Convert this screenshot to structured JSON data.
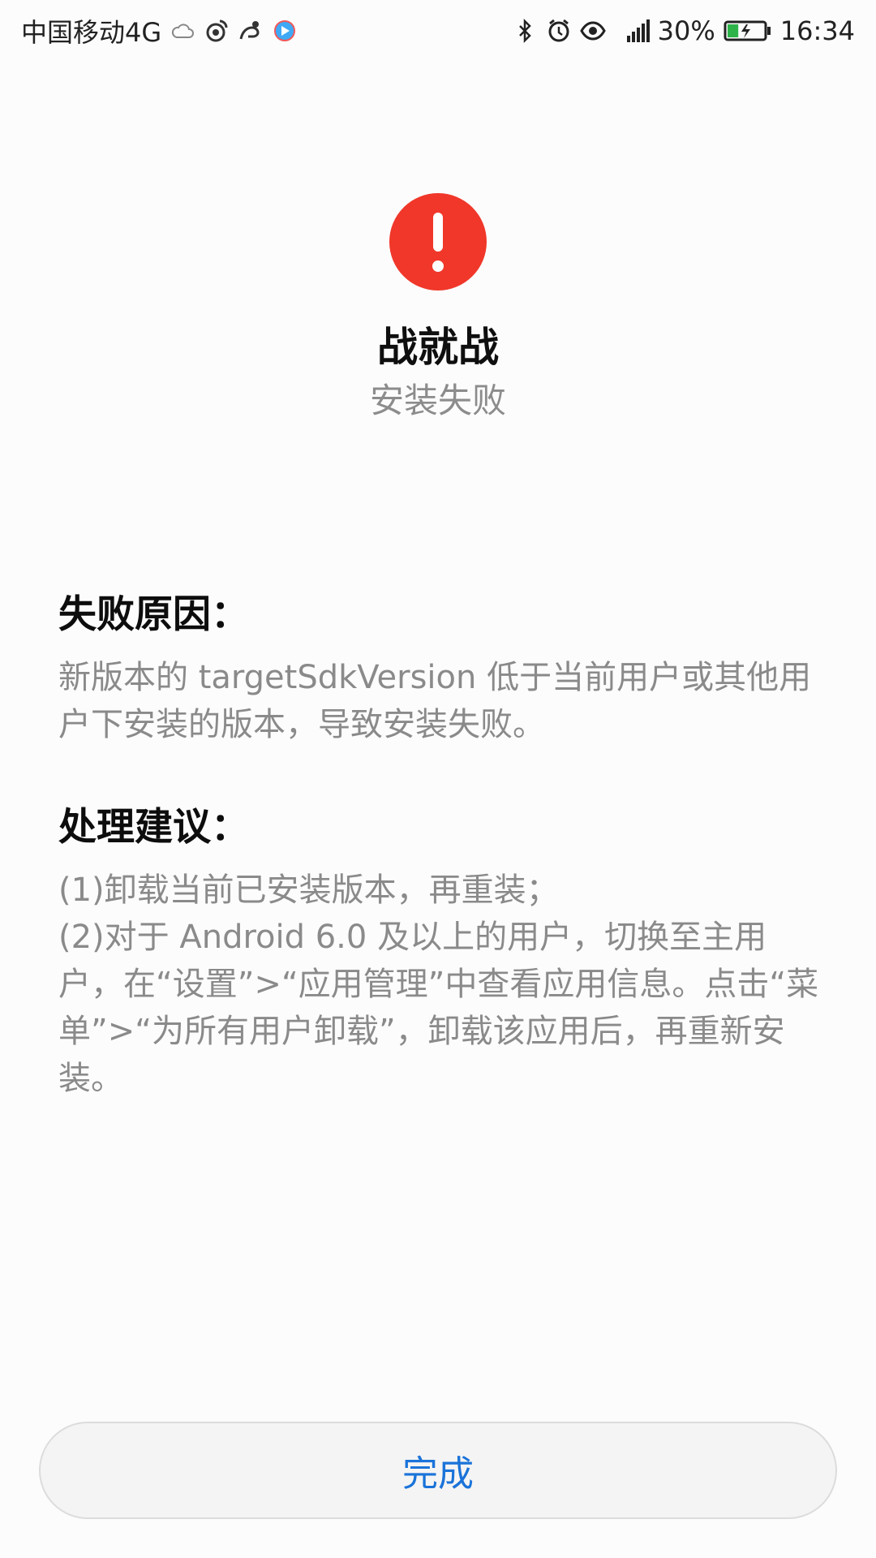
{
  "status_bar": {
    "carrier": "中国移动4G",
    "left_icons": [
      "cloud-icon",
      "weibo-icon",
      "uc-browser-icon",
      "video-app-icon"
    ],
    "right_icons": [
      "bluetooth-icon",
      "alarm-icon",
      "eye-icon",
      "signal-icon"
    ],
    "network_type": "4G",
    "battery_percent": "30%",
    "time": "16:34",
    "battery_level": 0.3,
    "battery_color": "#2db34a"
  },
  "header": {
    "icon": "error-icon",
    "icon_color": "#f0372a",
    "app_name": "战就战",
    "status": "安装失败"
  },
  "failure_reason": {
    "title": "失败原因：",
    "body": "新版本的 targetSdkVersion 低于当前用户或其他用户下安装的版本，导致安装失败。"
  },
  "suggestion": {
    "title": "处理建议：",
    "lines": [
      "(1)卸载当前已安装版本，再重装；",
      "(2)对于 Android 6.0 及以上的用户，切换至主用户，在“设置”>“应用管理”中查看应用信息。点击“菜单”>“为所有用户卸载”，卸载该应用后，再重新安装。"
    ]
  },
  "done_button": {
    "label": "完成",
    "color": "#1a73d9"
  }
}
